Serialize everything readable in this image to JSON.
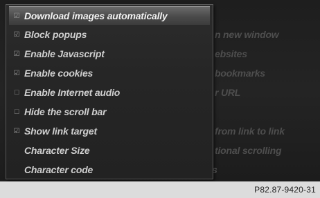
{
  "menu": {
    "items": [
      {
        "label": "Download images automatically",
        "checked": true,
        "selected": true
      },
      {
        "label": "Block popups",
        "checked": true,
        "selected": false
      },
      {
        "label": "Enable Javascript",
        "checked": true,
        "selected": false
      },
      {
        "label": "Enable cookies",
        "checked": true,
        "selected": false
      },
      {
        "label": "Enable Internet audio",
        "checked": false,
        "selected": false
      },
      {
        "label": "Hide the scroll bar",
        "checked": false,
        "selected": false
      },
      {
        "label": "Show link target",
        "checked": true,
        "selected": false
      },
      {
        "label": "Character Size",
        "checked": null,
        "selected": false
      },
      {
        "label": "Character code",
        "checked": null,
        "selected": false
      }
    ],
    "check_symbol": "☑",
    "empty_symbol": "☐"
  },
  "background_menu": {
    "items": [
      "n new window",
      "ebsites",
      "bookmarks",
      "r URL",
      "from link to link",
      "tional scrolling",
      "s"
    ]
  },
  "footer": {
    "reference_code": "P82.87-9420-31"
  }
}
